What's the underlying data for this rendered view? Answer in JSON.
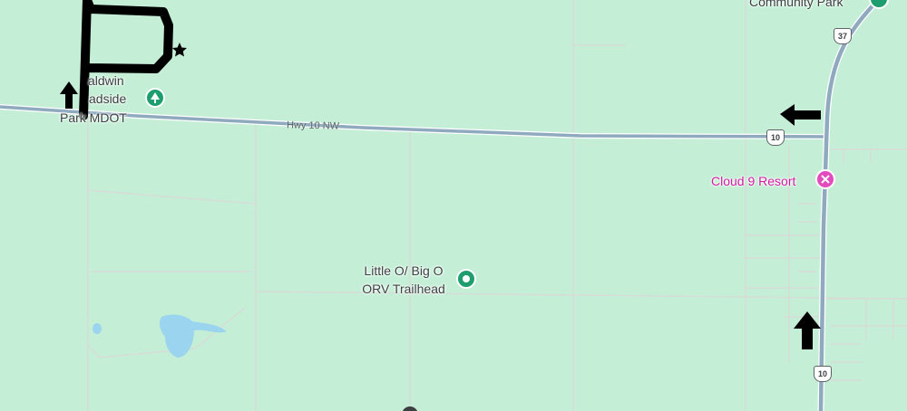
{
  "map": {
    "places": {
      "baldwin_line1": "aldwin",
      "baldwin_line2": "adside",
      "baldwin_line3": "Park MDOT",
      "community_park": "Community Park",
      "cloud9": "Cloud 9 Resort",
      "trailhead_line1": "Little O/ Big O",
      "trailhead_line2": "ORV Trailhead"
    },
    "roads": {
      "hwy10": "Hwy 10 NW",
      "us10_shield": "10",
      "us37_shield": "37"
    },
    "icons": {
      "baldwin_pin": "tree-icon",
      "trailhead_pin": "circle-icon",
      "cloud9_pin": "spa-icon",
      "arrows": "arrow-icon",
      "star": "star-icon"
    },
    "colors": {
      "land": "#c4efd6",
      "road_major": "#8fa9bf",
      "road_minor": "#d9ddd8",
      "water": "#9ad4ee",
      "poi_green": "#1e9e6e",
      "poi_pink": "#e34bbd",
      "annotation": "#000000"
    }
  }
}
